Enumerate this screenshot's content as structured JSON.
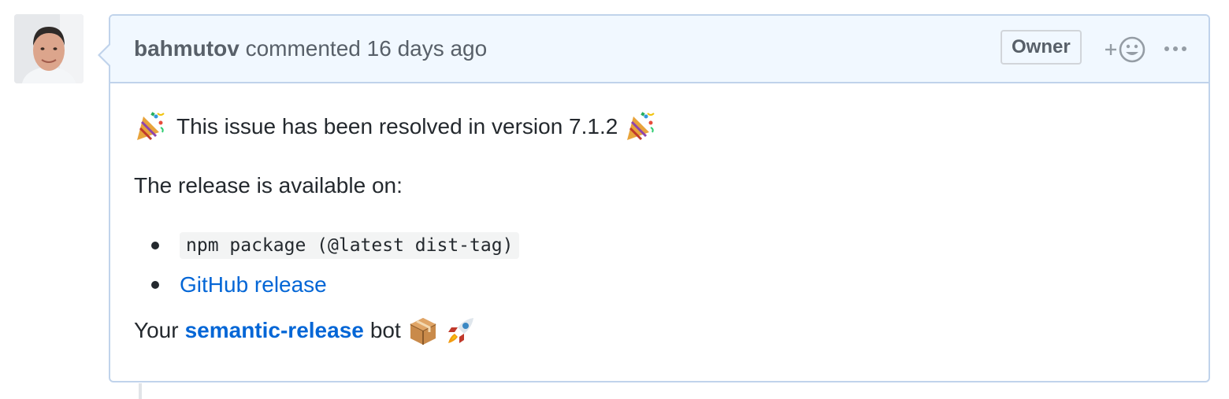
{
  "comment": {
    "author": "bahmutov",
    "action": "commented",
    "timestamp": "16 days ago",
    "badge": "Owner",
    "reaction_icon": "add-reaction-smiley-icon",
    "more_icon": "kebab-horizontal-icon",
    "body": {
      "resolved_text": "This issue has been resolved in version 7.1.2",
      "resolved_emoji": "party-popper",
      "release_intro": "The release is available on:",
      "items": [
        {
          "type": "code",
          "text": "npm package (@latest dist-tag)"
        },
        {
          "type": "link",
          "text": "GitHub release"
        }
      ],
      "signature_prefix": "Your",
      "signature_link": "semantic-release",
      "signature_suffix": "bot",
      "signature_emojis": [
        "package",
        "rocket"
      ]
    }
  },
  "colors": {
    "header_bg": "#f1f8ff",
    "border": "#c0d3eb",
    "link": "#0366d6",
    "text": "#24292e",
    "muted": "#586069"
  }
}
